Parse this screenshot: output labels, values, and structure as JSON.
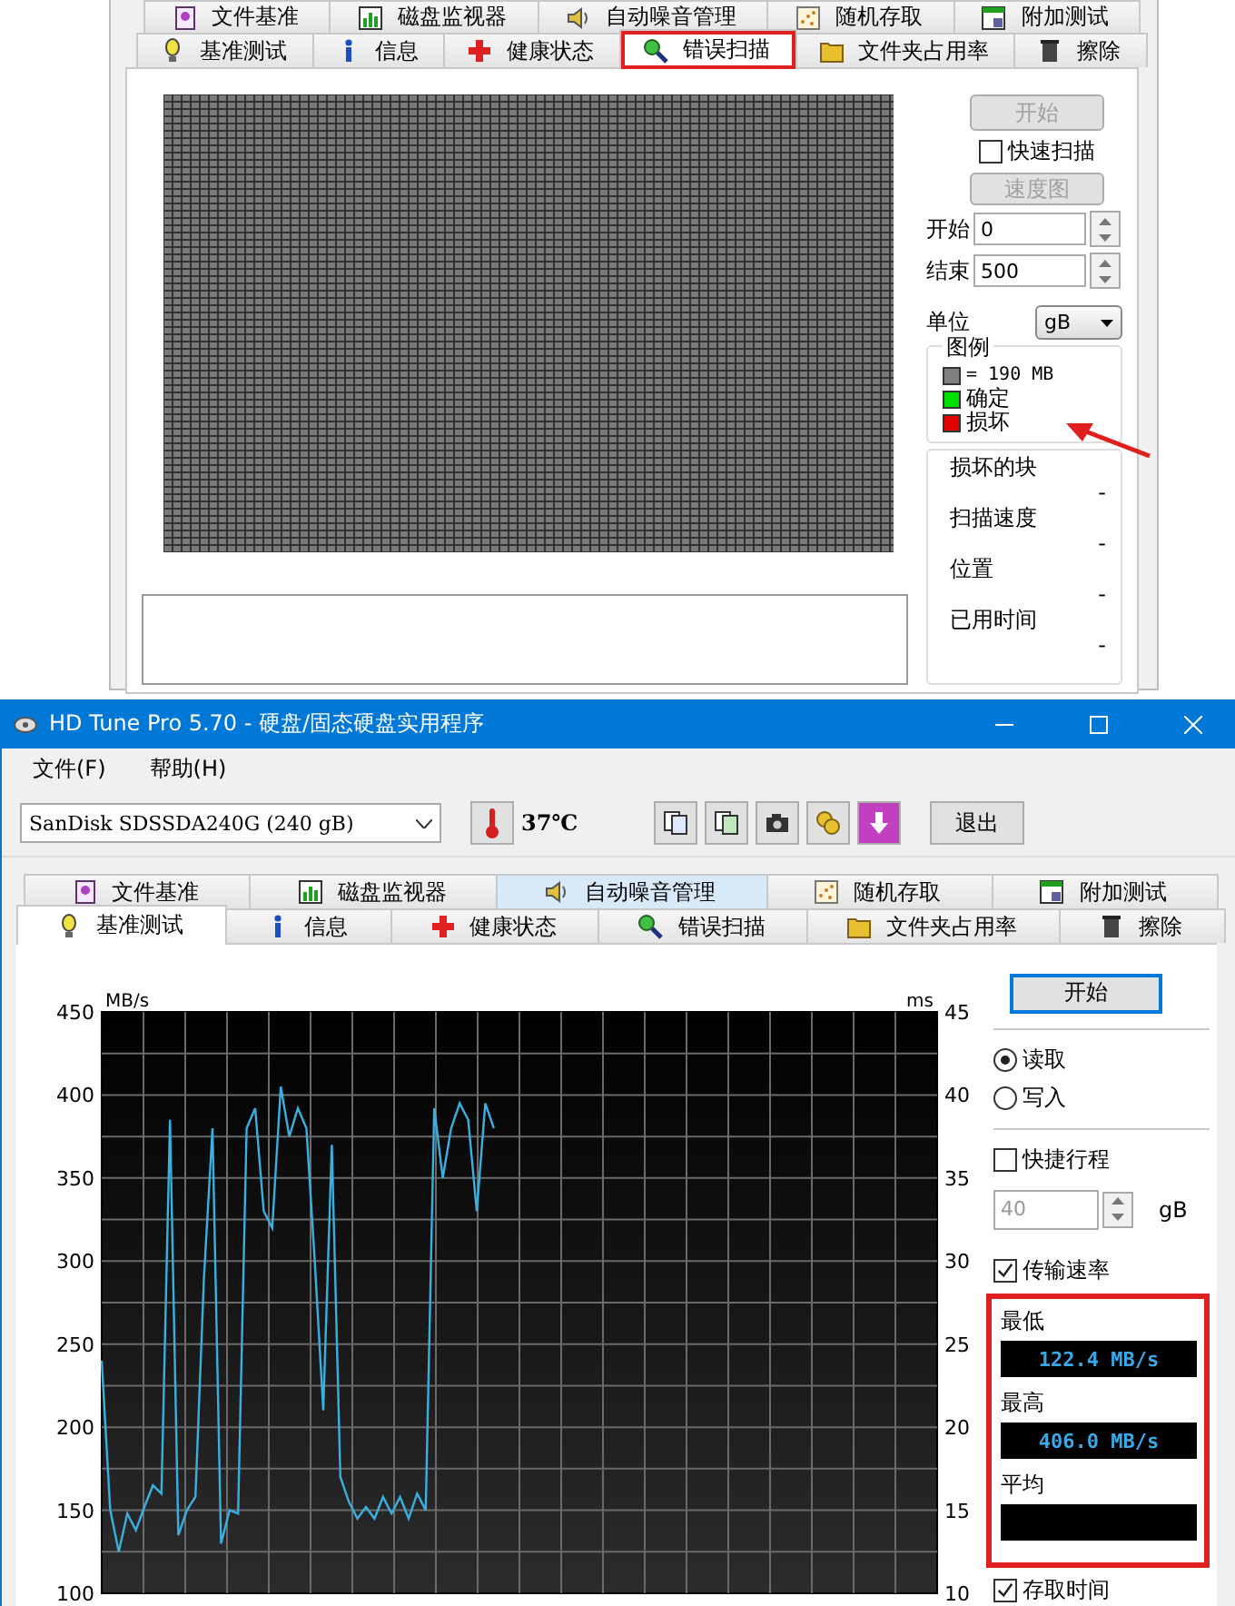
{
  "scan_window": {
    "tab_rows": [
      {
        "tabs": [
          {
            "label": "文件基准",
            "selected": false,
            "hovered": false,
            "highlighted": false
          },
          {
            "label": "磁盘监视器",
            "selected": false,
            "hovered": false,
            "highlighted": false
          },
          {
            "label": "自动噪音管理",
            "selected": false,
            "hovered": false,
            "highlighted": false
          },
          {
            "label": "随机存取",
            "selected": false,
            "hovered": false,
            "highlighted": false
          },
          {
            "label": "附加测试",
            "selected": false,
            "hovered": false,
            "highlighted": false
          }
        ]
      },
      {
        "tabs": [
          {
            "label": "基准测试",
            "selected": false,
            "hovered": false,
            "highlighted": false
          },
          {
            "label": "信息",
            "selected": false,
            "hovered": false,
            "highlighted": false
          },
          {
            "label": "健康状态",
            "selected": false,
            "hovered": false,
            "highlighted": false
          },
          {
            "label": "错误扫描",
            "selected": true,
            "hovered": false,
            "highlighted": true
          },
          {
            "label": "文件夹占用率",
            "selected": false,
            "hovered": false,
            "highlighted": false
          },
          {
            "label": "擦除",
            "selected": false,
            "hovered": false,
            "highlighted": false
          }
        ]
      }
    ],
    "start_button": {
      "label": "开始",
      "disabled": true
    },
    "quick_scan": {
      "label": "快速扫描",
      "checked": false
    },
    "speed_map_button": {
      "label": "速度图",
      "disabled": true
    },
    "range_fields": [
      {
        "label": "开始",
        "value": "0"
      },
      {
        "label": "结束",
        "value": "500"
      }
    ],
    "unit": {
      "label": "单位",
      "value": "gB"
    },
    "legend": {
      "title": "图例",
      "pointer_arrow": true,
      "items": [
        {
          "label": "= 190 MB",
          "color": "#808080"
        },
        {
          "label": "确定",
          "color": "#00e000"
        },
        {
          "label": "损坏",
          "color": "#e00000"
        }
      ]
    },
    "stats": [
      {
        "label": "损坏的块",
        "value": "-"
      },
      {
        "label": "扫描速度",
        "value": "-"
      },
      {
        "label": "位置",
        "value": "-"
      },
      {
        "label": "已用时间",
        "value": "-"
      }
    ]
  },
  "window": {
    "title": "HD Tune Pro 5.70 - 硬盘/固态硬盘实用程序"
  },
  "menu": [
    "文件(F)",
    "帮助(H)"
  ],
  "toolbar": {
    "drive": "SanDisk SDSSDA240G (240 gB)",
    "temperature": "37℃",
    "exit_button": "退出"
  },
  "tab_rows": [
    {
      "tabs": [
        {
          "label": "文件基准",
          "selected": false,
          "hovered": false,
          "highlighted": false
        },
        {
          "label": "磁盘监视器",
          "selected": false,
          "hovered": false,
          "highlighted": false
        },
        {
          "label": "自动噪音管理",
          "selected": false,
          "hovered": true,
          "highlighted": false
        },
        {
          "label": "随机存取",
          "selected": false,
          "hovered": false,
          "highlighted": false
        },
        {
          "label": "附加测试",
          "selected": false,
          "hovered": false,
          "highlighted": false
        }
      ]
    },
    {
      "tabs": [
        {
          "label": "基准测试",
          "selected": true,
          "hovered": false,
          "highlighted": false
        },
        {
          "label": "信息",
          "selected": false,
          "hovered": false,
          "highlighted": false
        },
        {
          "label": "健康状态",
          "selected": false,
          "hovered": false,
          "highlighted": false
        },
        {
          "label": "错误扫描",
          "selected": false,
          "hovered": false,
          "highlighted": false
        },
        {
          "label": "文件夹占用率",
          "selected": false,
          "hovered": false,
          "highlighted": false
        },
        {
          "label": "擦除",
          "selected": false,
          "hovered": false,
          "highlighted": false
        }
      ]
    }
  ],
  "benchmark": {
    "chart_data": {
      "type": "line",
      "ylabel": "MB/s",
      "y2label": "ms",
      "grid": true,
      "ylim": [
        100,
        450
      ],
      "yticks": [
        100,
        150,
        200,
        250,
        300,
        350,
        400,
        450
      ],
      "y2lim": [
        10,
        45
      ],
      "y2ticks": [
        10,
        15,
        20,
        25,
        30,
        35,
        40,
        45
      ],
      "series": [
        {
          "color": "#3ab0e0",
          "values": [
            240,
            150,
            125,
            148,
            138,
            152,
            165,
            160,
            385,
            135,
            150,
            158,
            290,
            380,
            130,
            150,
            148,
            380,
            392,
            330,
            320,
            405,
            375,
            392,
            380,
            300,
            210,
            370,
            170,
            155,
            145,
            152,
            145,
            158,
            148,
            158,
            145,
            160,
            150,
            392,
            350,
            380,
            395,
            385,
            330,
            395,
            380,
            null,
            null,
            null,
            null,
            null,
            null,
            null,
            null,
            null,
            null,
            null,
            null,
            null,
            null,
            null,
            null,
            null,
            null,
            null,
            null,
            null,
            null,
            null,
            null,
            null,
            null,
            null,
            null,
            null,
            null,
            null,
            null,
            null,
            null,
            null,
            null,
            null,
            null,
            null,
            null,
            null,
            null,
            null,
            null,
            null,
            null,
            null,
            null,
            null,
            null,
            null,
            null
          ]
        }
      ]
    },
    "start_button": {
      "label": "开始"
    },
    "modes": [
      {
        "label": "读取",
        "selected": true
      },
      {
        "label": "写入",
        "selected": false
      }
    ],
    "short_stroke": {
      "label": "快捷行程",
      "checked": false
    },
    "stroke_size": {
      "value": "40",
      "unit": "gB",
      "disabled": true
    },
    "transfer_rate": {
      "label": "传输速率",
      "checked": true
    },
    "readings": {
      "highlighted": true,
      "items": [
        {
          "label": "最低",
          "value": "122.4 MB/s"
        },
        {
          "label": "最高",
          "value": "406.0 MB/s"
        },
        {
          "label": "平均"
        }
      ]
    },
    "access_time": {
      "label": "存取时间",
      "checked": true
    }
  }
}
